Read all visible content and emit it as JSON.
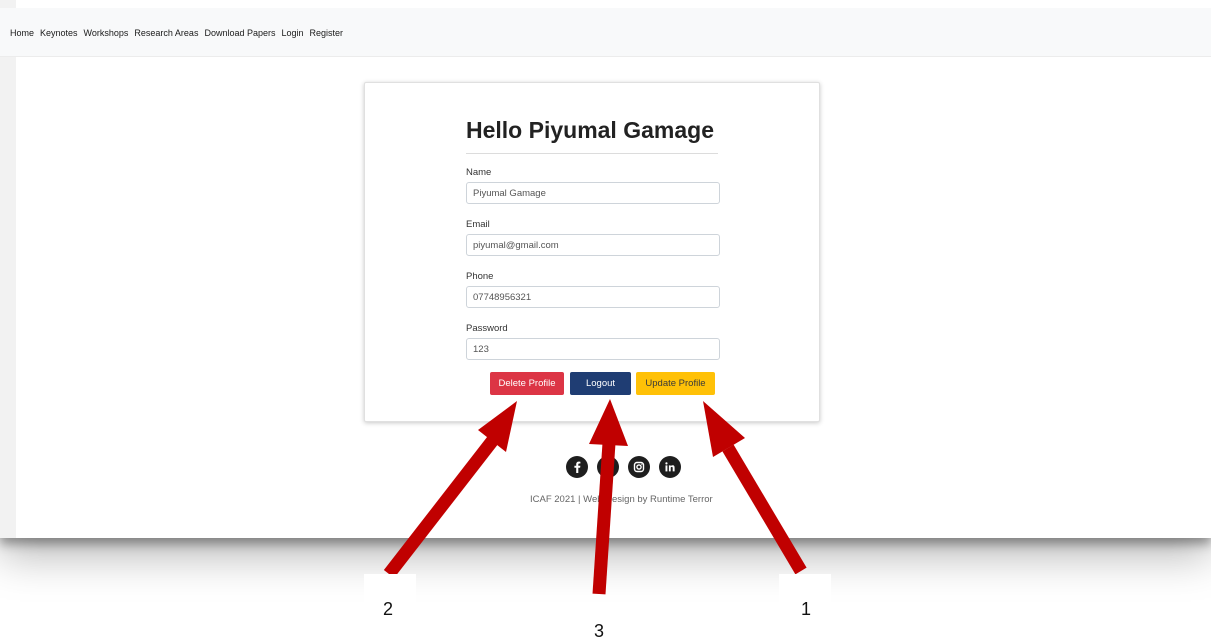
{
  "nav": {
    "links": [
      "Home",
      "Keynotes",
      "Workshops",
      "Research Areas",
      "Download Papers",
      "Login",
      "Register"
    ]
  },
  "profile": {
    "title": "Hello Piyumal Gamage",
    "fields": {
      "name": {
        "label": "Name",
        "value": "Piyumal Gamage"
      },
      "email": {
        "label": "Email",
        "value": "piyumal@gmail.com"
      },
      "phone": {
        "label": "Phone",
        "value": "07748956321"
      },
      "password": {
        "label": "Password",
        "value": "123"
      }
    },
    "buttons": {
      "delete": "Delete Profile",
      "logout": "Logout",
      "update": "Update Profile"
    }
  },
  "footer": {
    "social_icons": [
      "facebook-icon",
      "twitter-icon",
      "instagram-icon",
      "linkedin-icon"
    ],
    "text": "ICAF 2021 | Web Design by Runtime Terror"
  },
  "annotations": {
    "labels": [
      "1",
      "2",
      "3"
    ],
    "arrow_color": "#c00000"
  },
  "colors": {
    "delete": "#dc3545",
    "logout": "#1f3d73",
    "update": "#ffc107"
  }
}
